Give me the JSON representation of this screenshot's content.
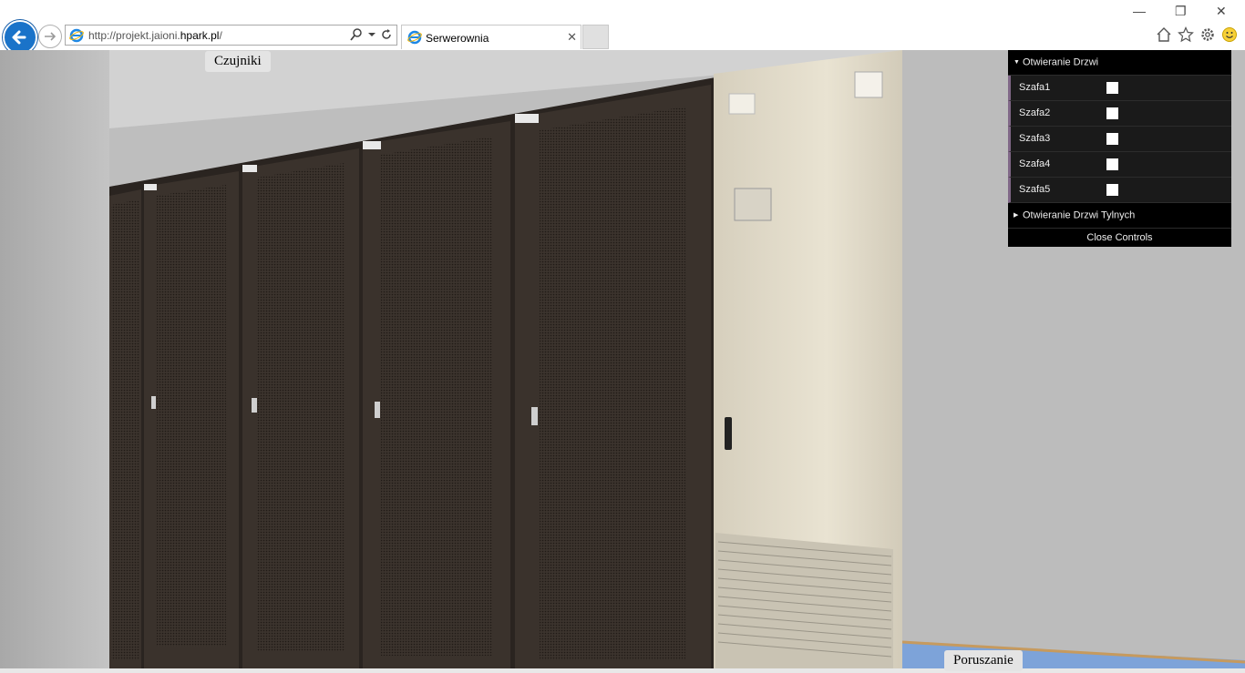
{
  "browser": {
    "url_prefix": "http://projekt.jaioni.",
    "url_host": "hpark.pl",
    "url_suffix": "/",
    "tab_title": "Serwerownia",
    "icons": [
      "back-arrow-icon",
      "forward-arrow-icon",
      "ie-logo-icon",
      "search-icon",
      "dropdown-icon",
      "refresh-icon",
      "tab-close-icon",
      "minimize-icon",
      "restore-icon",
      "window-close-icon",
      "home-icon",
      "favorites-star-icon",
      "settings-gear-icon",
      "smiley-feedback-icon"
    ]
  },
  "scene": {
    "sensors_button": "Czujniki",
    "move_button": "Poruszanie"
  },
  "controls": {
    "folder_doors": "Otwieranie Drzwi",
    "folder_doors_open": true,
    "cabinets": [
      {
        "label": "Szafa1",
        "checked": false
      },
      {
        "label": "Szafa2",
        "checked": false
      },
      {
        "label": "Szafa3",
        "checked": false
      },
      {
        "label": "Szafa4",
        "checked": false
      },
      {
        "label": "Szafa5",
        "checked": false
      }
    ],
    "folder_back_doors": "Otwieranie Drzwi Tylnych",
    "folder_back_doors_open": false,
    "close_label": "Close Controls"
  },
  "colors": {
    "accent": "#1a73c9",
    "gui_row_border": "#806787",
    "gui_bg": "#1a1a1a"
  }
}
